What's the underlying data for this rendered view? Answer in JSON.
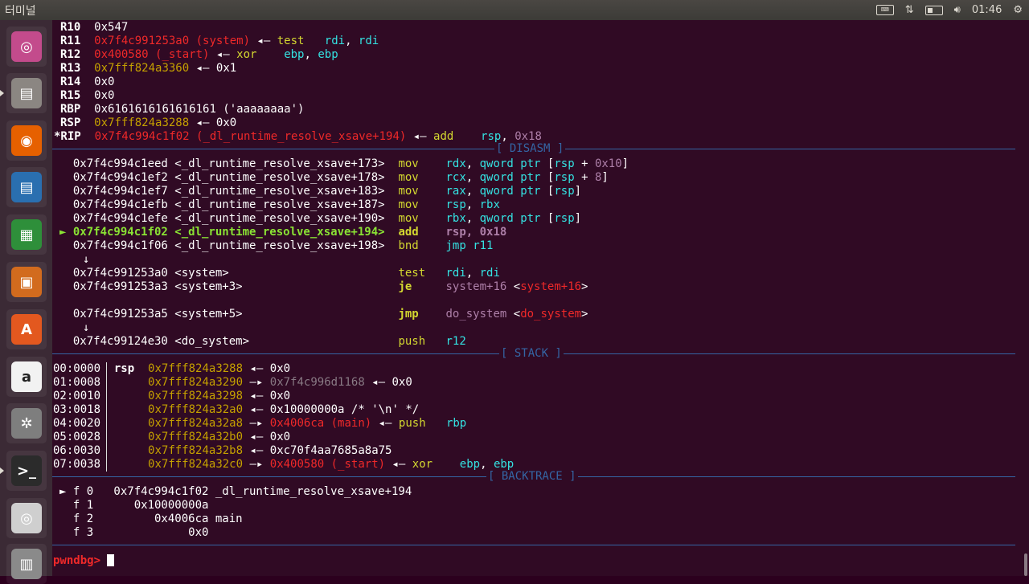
{
  "topbar": {
    "title": "터미널",
    "tray": {
      "keyboard_icon": "keyboard-icon",
      "network_icon": "network-updown-icon",
      "battery_icon": "battery-icon",
      "volume_icon": "volume-icon",
      "clock": "01:46",
      "settings_icon": "gear-icon"
    }
  },
  "launcher": [
    {
      "name": "ubuntu-dash",
      "icon": "ubuntu-logo-icon",
      "color": "#c34b8c",
      "glyph": "◎"
    },
    {
      "name": "files",
      "icon": "file-cabinet-icon",
      "color": "#8b8682",
      "glyph": "▤"
    },
    {
      "name": "firefox",
      "icon": "firefox-icon",
      "color": "#e66000",
      "glyph": "◉"
    },
    {
      "name": "libreoffice-writer",
      "icon": "writer-document-icon",
      "color": "#2a6fb0",
      "glyph": "▤"
    },
    {
      "name": "libreoffice-calc",
      "icon": "calc-spreadsheet-icon",
      "color": "#2e8f3a",
      "glyph": "▦"
    },
    {
      "name": "libreoffice-impress",
      "icon": "impress-presentation-icon",
      "color": "#d26b1e",
      "glyph": "▣"
    },
    {
      "name": "software-center",
      "icon": "shopping-bag-icon",
      "color": "#e3581f",
      "glyph": "A"
    },
    {
      "name": "amazon",
      "icon": "amazon-icon",
      "color": "#f2f2f2",
      "glyph": "a"
    },
    {
      "name": "system-settings",
      "icon": "wrench-gear-icon",
      "color": "#7e7e7e",
      "glyph": "✲"
    },
    {
      "name": "terminal",
      "icon": "terminal-icon",
      "color": "#2b2b2b",
      "glyph": ">_"
    },
    {
      "name": "dvd",
      "icon": "disc-icon",
      "color": "#cfcfcf",
      "glyph": "◎"
    },
    {
      "name": "trash",
      "icon": "trash-icon",
      "color": "#8a8a8a",
      "glyph": "▥"
    }
  ],
  "registers": [
    {
      "name": "R10 ",
      "segs": [
        [
          "",
          "0x547"
        ]
      ]
    },
    {
      "name": "R11 ",
      "segs": [
        [
          "red",
          "0x7f4c991253a0 (system)"
        ],
        [
          "",
          " ◂— "
        ],
        [
          "ygreen",
          "test"
        ],
        [
          "",
          "   "
        ],
        [
          "cyan",
          "rdi"
        ],
        [
          "",
          ", "
        ],
        [
          "cyan",
          "rdi"
        ]
      ]
    },
    {
      "name": "R12 ",
      "segs": [
        [
          "red",
          "0x400580 (_start)"
        ],
        [
          "",
          " ◂— "
        ],
        [
          "ygreen",
          "xor"
        ],
        [
          "",
          "    "
        ],
        [
          "cyan",
          "ebp"
        ],
        [
          "",
          ", "
        ],
        [
          "cyan",
          "ebp"
        ]
      ]
    },
    {
      "name": "R13 ",
      "segs": [
        [
          "gold",
          "0x7fff824a3360"
        ],
        [
          "",
          " ◂— 0x1"
        ]
      ]
    },
    {
      "name": "R14 ",
      "segs": [
        [
          "",
          "0x0"
        ]
      ]
    },
    {
      "name": "R15 ",
      "segs": [
        [
          "",
          "0x0"
        ]
      ]
    },
    {
      "name": "RBP ",
      "segs": [
        [
          "",
          "0x6161616161616161 ('aaaaaaaa')"
        ]
      ]
    },
    {
      "name": "RSP ",
      "segs": [
        [
          "gold",
          "0x7fff824a3288"
        ],
        [
          "",
          " ◂— 0x0"
        ]
      ]
    },
    {
      "name": "*RIP ",
      "segs": [
        [
          "red",
          "0x7f4c994c1f02 (_dl_runtime_resolve_xsave+194)"
        ],
        [
          "",
          " ◂— "
        ],
        [
          "ygreen",
          "add"
        ],
        [
          "",
          "    "
        ],
        [
          "cyan",
          "rsp"
        ],
        [
          "",
          ", "
        ],
        [
          "pur",
          "0x18"
        ]
      ]
    }
  ],
  "sections": {
    "disasm": "[ DISASM ]",
    "stack": "[ STACK ]",
    "backtrace": "[ BACKTRACE ]"
  },
  "disasm": [
    {
      "marker": "",
      "addr": "0x7f4c994c1eed <_dl_runtime_resolve_xsave+173>",
      "mn": "mov",
      "ops": [
        [
          "cyan",
          "rdx"
        ],
        [
          "",
          ", "
        ],
        [
          "cyan",
          "qword ptr"
        ],
        [
          "",
          " ["
        ],
        [
          "cyan",
          "rsp"
        ],
        [
          "",
          " + "
        ],
        [
          "pur",
          "0x10"
        ],
        [
          "",
          "]"
        ]
      ]
    },
    {
      "marker": "",
      "addr": "0x7f4c994c1ef2 <_dl_runtime_resolve_xsave+178>",
      "mn": "mov",
      "ops": [
        [
          "cyan",
          "rcx"
        ],
        [
          "",
          ", "
        ],
        [
          "cyan",
          "qword ptr"
        ],
        [
          "",
          " ["
        ],
        [
          "cyan",
          "rsp"
        ],
        [
          "",
          " + "
        ],
        [
          "pur",
          "8"
        ],
        [
          "",
          "]"
        ]
      ]
    },
    {
      "marker": "",
      "addr": "0x7f4c994c1ef7 <_dl_runtime_resolve_xsave+183>",
      "mn": "mov",
      "ops": [
        [
          "cyan",
          "rax"
        ],
        [
          "",
          ", "
        ],
        [
          "cyan",
          "qword ptr"
        ],
        [
          "",
          " ["
        ],
        [
          "cyan",
          "rsp"
        ],
        [
          "",
          "]"
        ]
      ]
    },
    {
      "marker": "",
      "addr": "0x7f4c994c1efb <_dl_runtime_resolve_xsave+187>",
      "mn": "mov",
      "ops": [
        [
          "cyan",
          "rsp"
        ],
        [
          "",
          ", "
        ],
        [
          "cyan",
          "rbx"
        ]
      ]
    },
    {
      "marker": "",
      "addr": "0x7f4c994c1efe <_dl_runtime_resolve_xsave+190>",
      "mn": "mov",
      "ops": [
        [
          "cyan",
          "rbx"
        ],
        [
          "",
          ", "
        ],
        [
          "cyan",
          "qword ptr"
        ],
        [
          "",
          " ["
        ],
        [
          "cyan",
          "rsp"
        ],
        [
          "",
          "]"
        ]
      ]
    },
    {
      "marker": "►",
      "addr": "0x7f4c994c1f02 <_dl_runtime_resolve_xsave+194>",
      "mn": "add",
      "ops": [
        [
          "bpur",
          "rsp"
        ],
        [
          "bpur",
          ", "
        ],
        [
          "bpur",
          "0x18"
        ]
      ],
      "current": true
    },
    {
      "marker": "",
      "addr": "0x7f4c994c1f06 <_dl_runtime_resolve_xsave+198>",
      "mn": "bnd",
      "ops": [
        [
          "cyan",
          "jmp"
        ],
        [
          "",
          " "
        ],
        [
          "cyan",
          "r11"
        ]
      ],
      "plainmn": true
    },
    {
      "arrow": "↓"
    },
    {
      "marker": "",
      "addr": "0x7f4c991253a0 <system>",
      "mn": "test",
      "ops": [
        [
          "cyan",
          "rdi"
        ],
        [
          "",
          ", "
        ],
        [
          "cyan",
          "rdi"
        ]
      ]
    },
    {
      "marker": "",
      "addr": "0x7f4c991253a3 <system+3>",
      "mn": "je",
      "ops": [
        [
          "pur",
          "system+16"
        ],
        [
          "",
          " <"
        ],
        [
          "red",
          "system+16"
        ],
        [
          "",
          ">"
        ]
      ],
      "boldmn": true
    },
    {
      "blank": true
    },
    {
      "marker": "",
      "addr": "0x7f4c991253a5 <system+5>",
      "mn": "jmp",
      "ops": [
        [
          "pur",
          "do_system"
        ],
        [
          "",
          " <"
        ],
        [
          "red",
          "do_system"
        ],
        [
          "",
          ">"
        ]
      ],
      "boldmn": true
    },
    {
      "arrow": "↓"
    },
    {
      "marker": "",
      "addr": "0x7f4c99124e30 <do_system>",
      "mn": "push",
      "ops": [
        [
          "cyan",
          "r12"
        ]
      ]
    }
  ],
  "stack": [
    {
      "off": "00:0000",
      "label": "rsp",
      "addr": "0x7fff824a3288",
      "rest": [
        [
          "",
          " ◂— 0x0"
        ]
      ]
    },
    {
      "off": "01:0008",
      "label": "",
      "addr": "0x7fff824a3290",
      "rest": [
        [
          "",
          " —▸ "
        ],
        [
          "gray",
          "0x7f4c996d1168"
        ],
        [
          "",
          " ◂— 0x0"
        ]
      ]
    },
    {
      "off": "02:0010",
      "label": "",
      "addr": "0x7fff824a3298",
      "rest": [
        [
          "",
          " ◂— 0x0"
        ]
      ]
    },
    {
      "off": "03:0018",
      "label": "",
      "addr": "0x7fff824a32a0",
      "rest": [
        [
          "",
          " ◂— 0x10000000a /* '\\n' */"
        ]
      ]
    },
    {
      "off": "04:0020",
      "label": "",
      "addr": "0x7fff824a32a8",
      "rest": [
        [
          "",
          " —▸ "
        ],
        [
          "red",
          "0x4006ca (main)"
        ],
        [
          "",
          " ◂— "
        ],
        [
          "ygreen",
          "push"
        ],
        [
          "",
          "   "
        ],
        [
          "cyan",
          "rbp"
        ]
      ]
    },
    {
      "off": "05:0028",
      "label": "",
      "addr": "0x7fff824a32b0",
      "rest": [
        [
          "",
          " ◂— 0x0"
        ]
      ]
    },
    {
      "off": "06:0030",
      "label": "",
      "addr": "0x7fff824a32b8",
      "rest": [
        [
          "",
          " ◂— 0xc70f4aa7685a8a75"
        ]
      ]
    },
    {
      "off": "07:0038",
      "label": "",
      "addr": "0x7fff824a32c0",
      "rest": [
        [
          "",
          " —▸ "
        ],
        [
          "red",
          "0x400580 (_start)"
        ],
        [
          "",
          " ◂— "
        ],
        [
          "ygreen",
          "xor"
        ],
        [
          "",
          "    "
        ],
        [
          "cyan",
          "ebp"
        ],
        [
          "",
          ", "
        ],
        [
          "cyan",
          "ebp"
        ]
      ]
    }
  ],
  "backtrace": [
    "► f 0   0x7f4c994c1f02 _dl_runtime_resolve_xsave+194",
    "  f 1      0x10000000a",
    "  f 2         0x4006ca main",
    "  f 3              0x0"
  ],
  "prompt": "pwndbg> ",
  "colors": {
    "terminal_bg": "#300a24",
    "prompt": "#ef2929",
    "separator": "#3465a4"
  }
}
